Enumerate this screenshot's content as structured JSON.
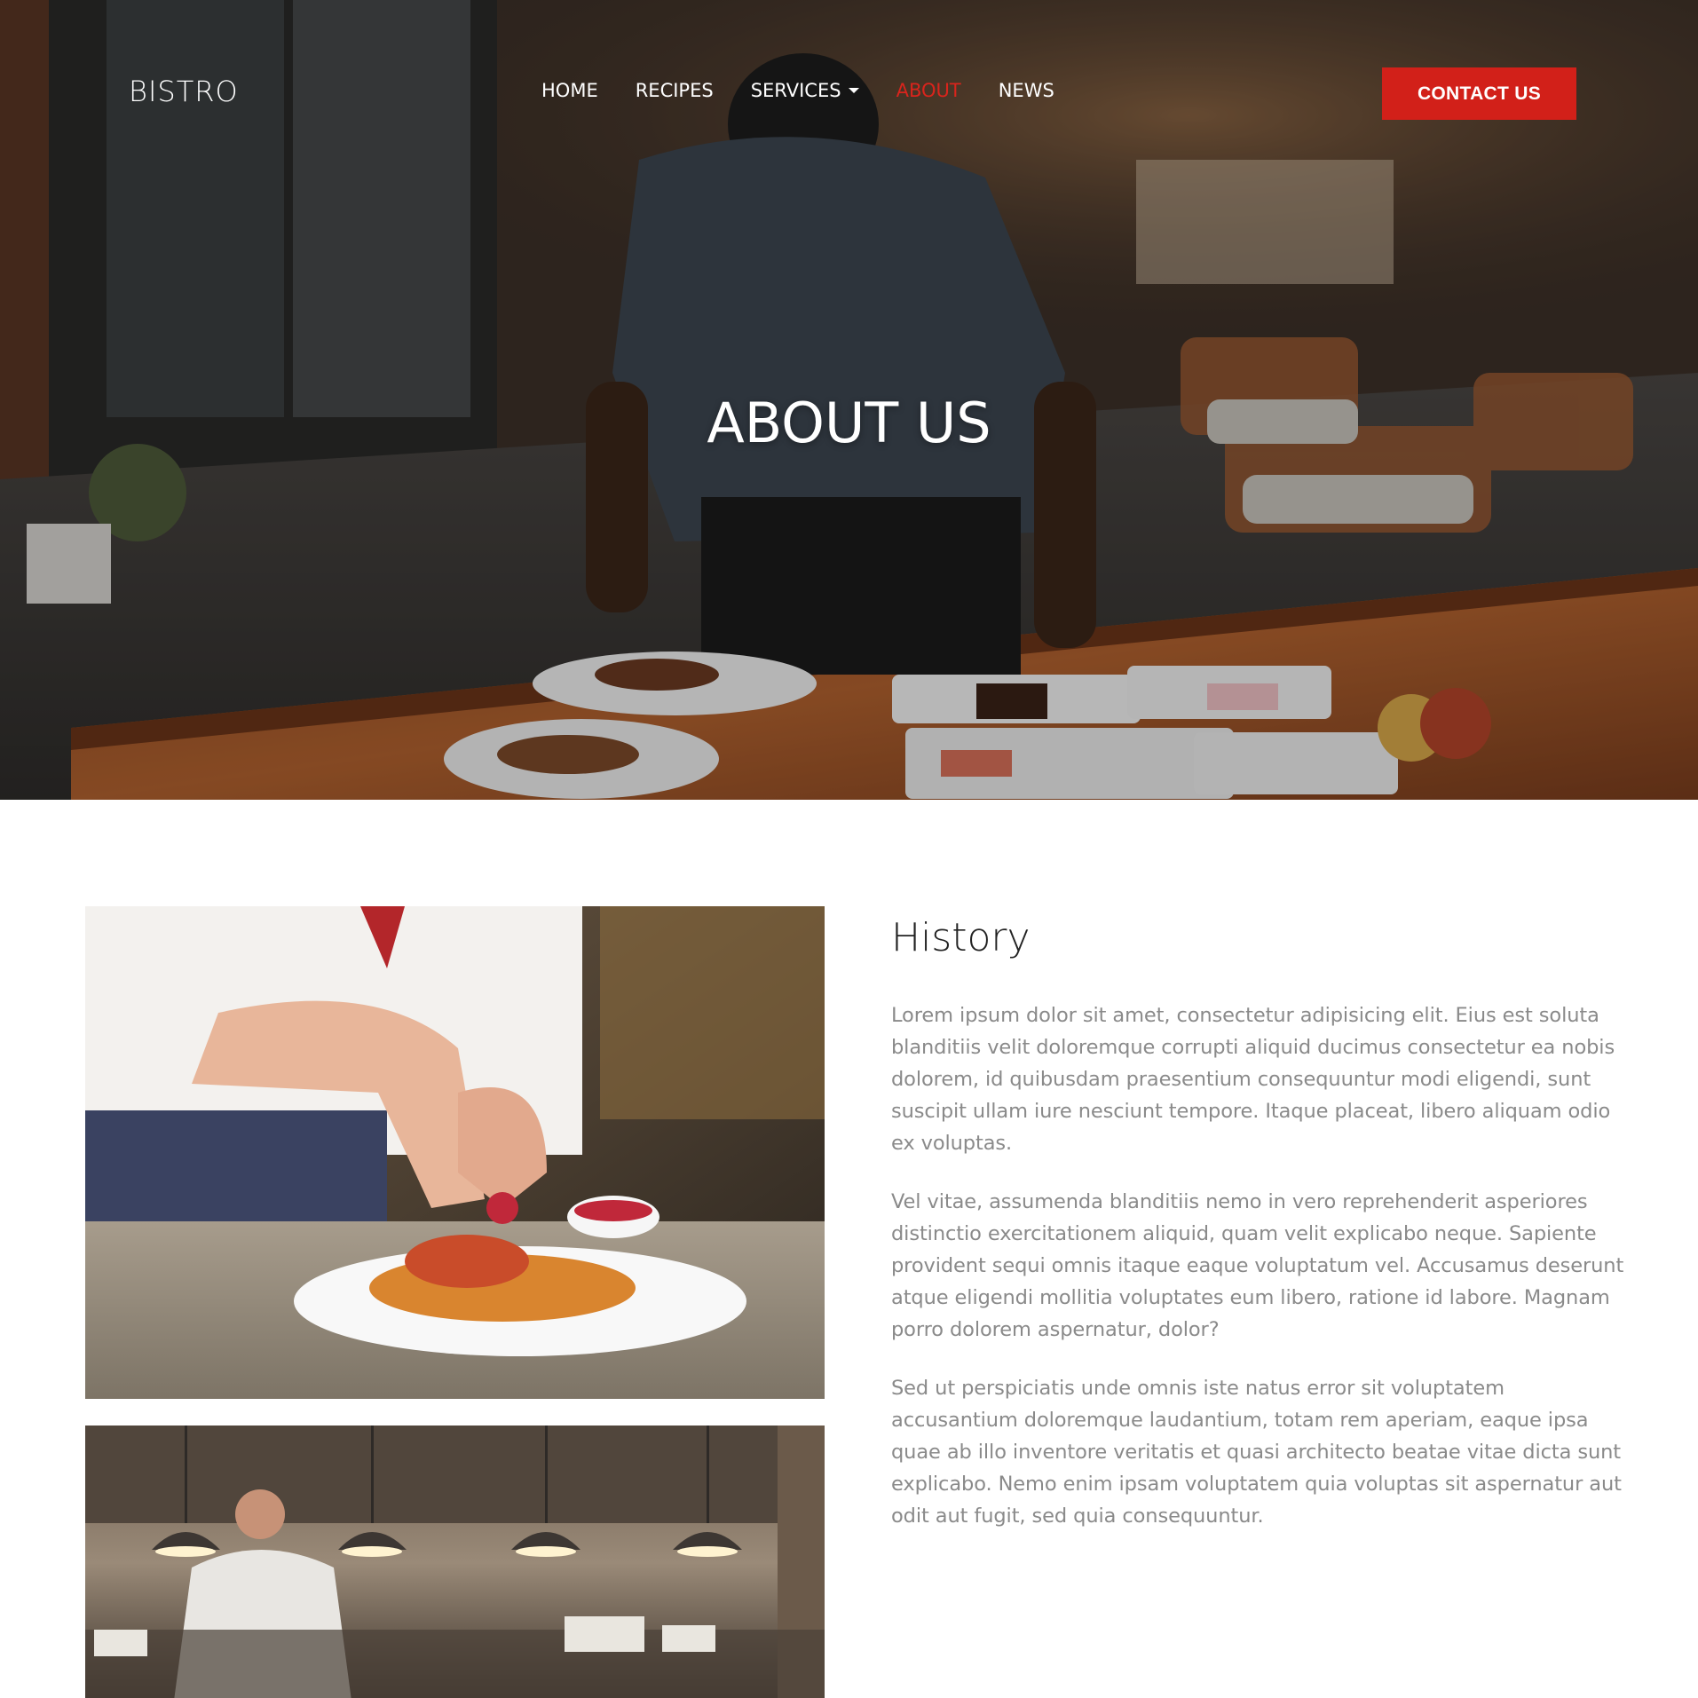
{
  "brand": "BISTRO",
  "nav": {
    "items": [
      {
        "label": "HOME"
      },
      {
        "label": "RECIPES"
      },
      {
        "label": "SERVICES"
      },
      {
        "label": "ABOUT"
      },
      {
        "label": "NEWS"
      }
    ],
    "contact_label": "CONTACT US"
  },
  "hero": {
    "title": "ABOUT US"
  },
  "history": {
    "title": "History",
    "paragraphs": [
      "Lorem ipsum dolor sit amet, consectetur adipisicing elit. Eius est soluta blanditiis velit doloremque corrupti aliquid ducimus consectetur ea nobis dolorem, id quibusdam praesentium consequuntur modi eligendi, sunt suscipit ullam iure nesciunt tempore. Itaque placeat, libero aliquam odio ex voluptas.",
      "Vel vitae, assumenda blanditiis nemo in vero reprehenderit asperiores distinctio exercitationem aliquid, quam velit explicabo neque. Sapiente provident sequi omnis itaque eaque voluptatum vel. Accusamus deserunt atque eligendi mollitia voluptates eum libero, ratione id labore. Magnam porro dolorem aspernatur, dolor?",
      "Sed ut perspiciatis unde omnis iste natus error sit voluptatem accusantium doloremque laudantium, totam rem aperiam, eaque ipsa quae ab illo inventore veritatis et quasi architecto beatae vitae dicta sunt explicabo. Nemo enim ipsam voluptatem quia voluptas sit aspernatur aut odit aut fugit, sed quia consequuntur."
    ]
  },
  "colors": {
    "accent": "#d22019",
    "nav_active": "#d9241c",
    "body_text": "#8a8a8a",
    "heading_text": "#222222"
  }
}
